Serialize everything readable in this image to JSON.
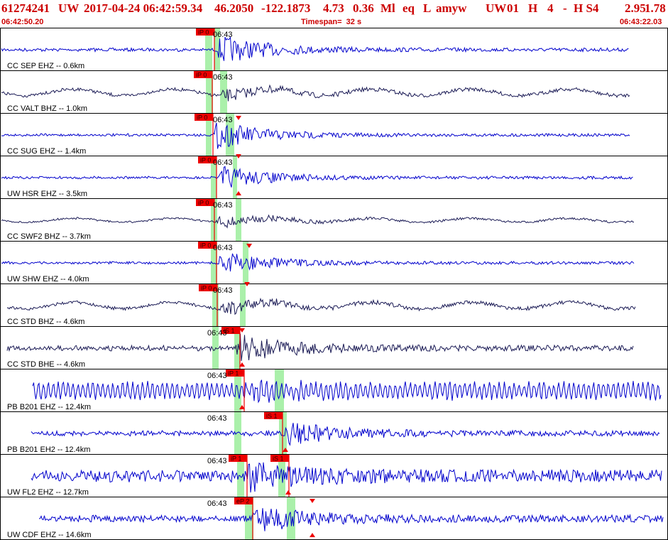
{
  "header": {
    "event_id": "61274241",
    "network": "UW",
    "origin_datetime": "2017-04-24 06:42:59.34",
    "latitude": "46.2050",
    "longitude": "-122.1873",
    "depth": "4.73",
    "magnitude": "0.36",
    "mag_type": "Ml",
    "event_type": "eq",
    "flag": "L",
    "analyst": "amyw",
    "network2": "UW",
    "version": "01",
    "quality": "H",
    "count": "4",
    "dash": "-",
    "sta": "H S4",
    "val1": "2.95",
    "val2": "1.78"
  },
  "time_bar": {
    "start": "06:42:50.20",
    "timespan": "Timespan=  32 s",
    "end": "06:43:22.03"
  },
  "tick_label": "06:43",
  "colors": {
    "title": "#cc0000",
    "border": "#000000",
    "pick": "#ee0000",
    "window": "#aaf0aa",
    "ehz_trace": "#0000cc",
    "bh_trace": "#1a1a55"
  },
  "traces": [
    {
      "label": "CC SEP EHZ -- 0.6km",
      "picks": [
        "iP 0"
      ],
      "color": "blue"
    },
    {
      "label": "CC VALT BHZ -- 1.0km",
      "picks": [
        "iP 0"
      ],
      "color": "dark"
    },
    {
      "label": "CC SUG EHZ -- 1.4km",
      "picks": [
        "iP 0"
      ],
      "color": "blue"
    },
    {
      "label": "UW HSR EHZ -- 3.5km",
      "picks": [
        "iP 0"
      ],
      "color": "blue"
    },
    {
      "label": "CC SWF2 BHZ -- 3.7km",
      "picks": [
        "iP 0"
      ],
      "color": "dark"
    },
    {
      "label": "UW SHW EHZ -- 4.0km",
      "picks": [
        "iP 0"
      ],
      "color": "blue"
    },
    {
      "label": "CC STD BHZ -- 4.6km",
      "picks": [
        "iP 0"
      ],
      "color": "dark"
    },
    {
      "label": "CC STD BHE -- 4.6km",
      "picks": [
        "iS 1"
      ],
      "color": "dark"
    },
    {
      "label": "PB B201 EHZ -- 12.4km",
      "picks": [
        "iP 1"
      ],
      "color": "blue"
    },
    {
      "label": "PB B201 EH2 -- 12.4km",
      "picks": [
        "iS 1"
      ],
      "color": "blue"
    },
    {
      "label": "UW FL2 EHZ -- 12.7km",
      "picks": [
        "iP 1",
        "iS 1"
      ],
      "color": "blue"
    },
    {
      "label": "UW CDF EHZ -- 14.6km",
      "picks": [
        "eP 2"
      ],
      "color": "blue"
    }
  ]
}
